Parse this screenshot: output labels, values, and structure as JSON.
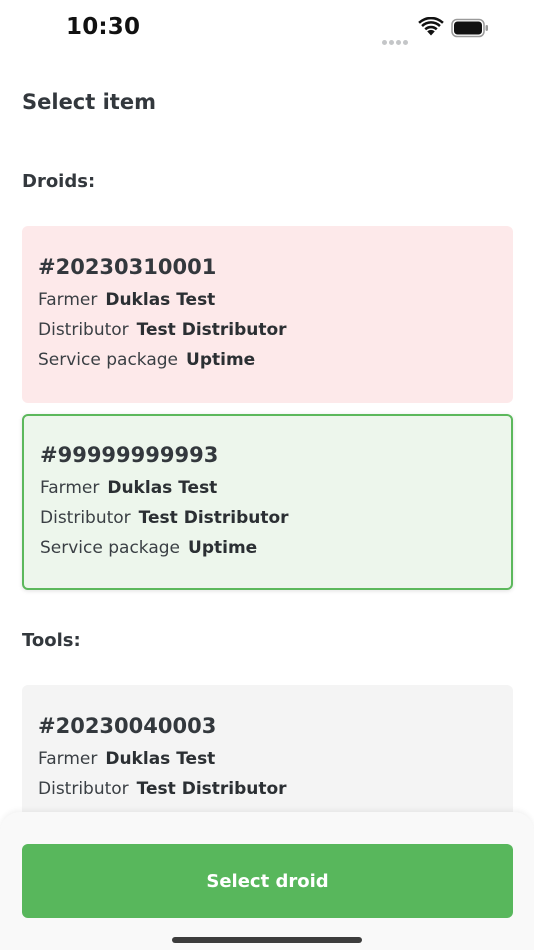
{
  "status_bar": {
    "time": "10:30",
    "icons": [
      "signal-dots-icon",
      "wifi-icon",
      "battery-icon"
    ]
  },
  "page": {
    "title": "Select item"
  },
  "sections": {
    "droids_label": "Droids:",
    "tools_label": "Tools:"
  },
  "droids": [
    {
      "id": "#20230310001",
      "state": "unavailable",
      "background": "#fde9ea",
      "rows": [
        {
          "label": "Farmer",
          "value": "Duklas Test"
        },
        {
          "label": "Distributor",
          "value": "Test Distributor"
        },
        {
          "label": "Service package",
          "value": "Uptime"
        }
      ]
    },
    {
      "id": "#99999999993",
      "state": "selected",
      "background": "#edf6ec",
      "border": "#5cb85c",
      "rows": [
        {
          "label": "Farmer",
          "value": "Duklas Test"
        },
        {
          "label": "Distributor",
          "value": "Test Distributor"
        },
        {
          "label": "Service package",
          "value": "Uptime"
        }
      ]
    }
  ],
  "tools": [
    {
      "id": "#20230040003",
      "background": "#f4f4f4",
      "rows": [
        {
          "label": "Farmer",
          "value": "Duklas Test"
        },
        {
          "label": "Distributor",
          "value": "Test Distributor"
        }
      ]
    }
  ],
  "footer": {
    "button_label": "Select droid",
    "button_color": "#58b75c"
  }
}
